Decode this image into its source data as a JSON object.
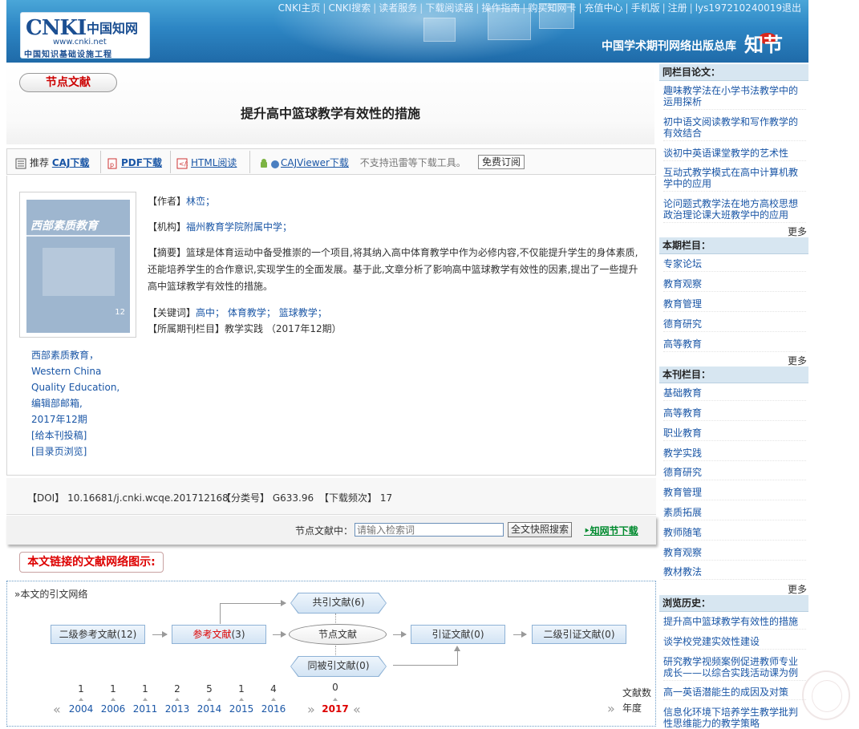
{
  "header": {
    "nav": [
      "CNKI主页",
      "CNKI搜索",
      "读者服务",
      "下载阅读器",
      "操作指南",
      "购买知网卡",
      "充值中心",
      "手机版",
      "注册",
      "lys197210240019退出"
    ],
    "logo_cnki": "CNKI",
    "logo_cn": "中国知网",
    "logo_url": "www.cnki.net",
    "logo_sub": "中国知识基础设施工程",
    "slogan": "中国学术期刊网络出版总库",
    "festival": "知节"
  },
  "node_label": "节点文献",
  "article_title": "提升高中篮球教学有效性的措施",
  "toolbar": {
    "recommend": "推荐",
    "caj": "CAJ下载",
    "pdf": "PDF下载",
    "html": "HTML阅读",
    "cajviewer": "CAJViewer下载",
    "note": "不支持迅雷等下载工具。",
    "subscribe": "免费订阅"
  },
  "cover": {
    "title": "西部素质教育",
    "issue_no": "12"
  },
  "publication": [
    "西部素质教育，",
    "Western China",
    "Quality Education,",
    "编辑部邮箱,",
    "2017年12期",
    "[给本刊投稿]",
    "[目录页浏览]"
  ],
  "meta": {
    "author_label": "【作者】",
    "author": "林峦；",
    "org_label": "【机构】",
    "org": "福州教育学院附属中学；",
    "abstract_label": "【摘要】",
    "abstract": "篮球是体育运动中备受推崇的一个项目,将其纳入高中体育教学中作为必修内容,不仅能提升学生的身体素质,还能培养学生的合作意识,实现学生的全面发展。基于此,文章分析了影响高中篮球教学有效性的因素,提出了一些提升高中篮球教学有效性的措施。",
    "kw_label": "【关键词】",
    "keywords": [
      "高中；",
      "体育教学；",
      "篮球教学；"
    ],
    "column_label": "【所属期刊栏目】",
    "column": "教学实践 （2017年12期）"
  },
  "doi": {
    "doi_label": "【DOI】",
    "doi": "10.16681/j.cnki.wcqe.201712168",
    "cls_label": "【分类号】",
    "cls": "G633.96",
    "dl_label": "【下载频次】",
    "dl": "17"
  },
  "search": {
    "label": "节点文献中：",
    "placeholder": "请输入检索词",
    "button": "全文快照搜索",
    "download": "知网节下载"
  },
  "network": {
    "pill": "本文链接的文献网络图示:",
    "header": "»本文的引文网络",
    "co_cite": "共引文献(6)",
    "lvl2_ref": "二级参考文献(12)",
    "ref_label": "参考文献",
    "ref_count": "(3)",
    "node": "节点文献",
    "cited": "引证文献(0)",
    "lvl2_cited": "二级引证文献(0)",
    "co_cited": "同被引文献(0)",
    "counts": [
      "1",
      "1",
      "1",
      "2",
      "5",
      "1",
      "4"
    ],
    "years": [
      "2004",
      "2006",
      "2011",
      "2013",
      "2014",
      "2015",
      "2016"
    ],
    "current_count": "0",
    "current_year": "2017",
    "count_label": "文献数",
    "year_label": "年度",
    "prev": "«",
    "next": "»",
    "prev2": "«"
  },
  "sidebar": {
    "same_column_title": "同栏目论文：",
    "same_column": [
      "趣味教学法在小学书法教学中的运用探析",
      "初中语文阅读教学和写作教学的有效结合",
      "谈初中英语课堂教学的艺术性",
      "互动式教学模式在高中计算机教学中的应用",
      "论问题式教学法在地方高校思想政治理论课大班教学中的应用"
    ],
    "issue_column_title": "本期栏目：",
    "issue_columns": [
      "专家论坛",
      "教育观察",
      "教育管理",
      "德育研究",
      "高等教育"
    ],
    "journal_column_title": "本刊栏目：",
    "journal_columns": [
      "基础教育",
      "高等教育",
      "职业教育",
      "教学实践",
      "德育研究",
      "教育管理",
      "素质拓展",
      "教师随笔",
      "教育观察",
      "教材教法"
    ],
    "history_title": "浏览历史：",
    "history": [
      "提升高中篮球教学有效性的措施",
      "谈学校党建实效性建设",
      "研究教学视频案例促进教师专业成长——以综合实践活动课为例",
      "高一英语潜能生的成因及对策",
      "信息化环境下培养学生教学批判性思维能力的教学策略"
    ],
    "more": "更多"
  }
}
